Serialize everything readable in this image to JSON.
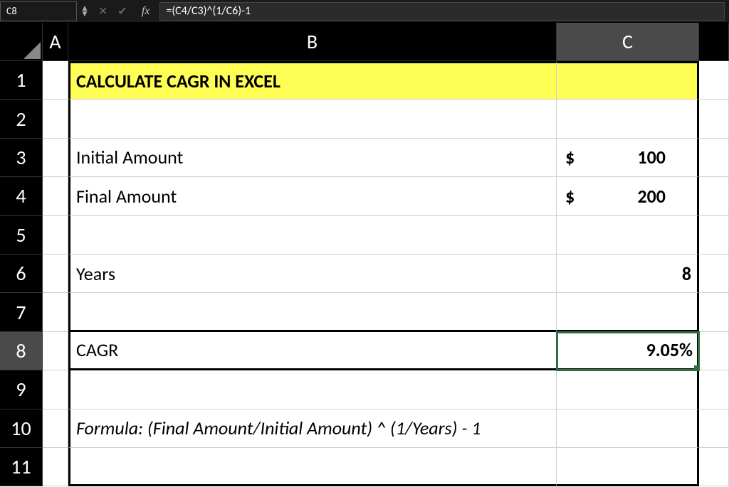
{
  "formula_bar": {
    "cell_ref": "C8",
    "fx_label": "fx",
    "formula": "=(C4/C3)^(1/C6)-1"
  },
  "columns": {
    "a": "A",
    "b": "B",
    "c": "C"
  },
  "rows": [
    "1",
    "2",
    "3",
    "4",
    "5",
    "6",
    "7",
    "8",
    "9",
    "10",
    "11"
  ],
  "content": {
    "title": "CALCULATE CAGR IN EXCEL",
    "initial_label": "Initial Amount",
    "initial_currency": "$",
    "initial_value": "100",
    "final_label": "Final Amount",
    "final_currency": "$",
    "final_value": "200",
    "years_label": "Years",
    "years_value": "8",
    "cagr_label": "CAGR",
    "cagr_value": "9.05%",
    "formula_note": "Formula: (Final Amount/Initial Amount) ^ (1/Years) - 1"
  }
}
